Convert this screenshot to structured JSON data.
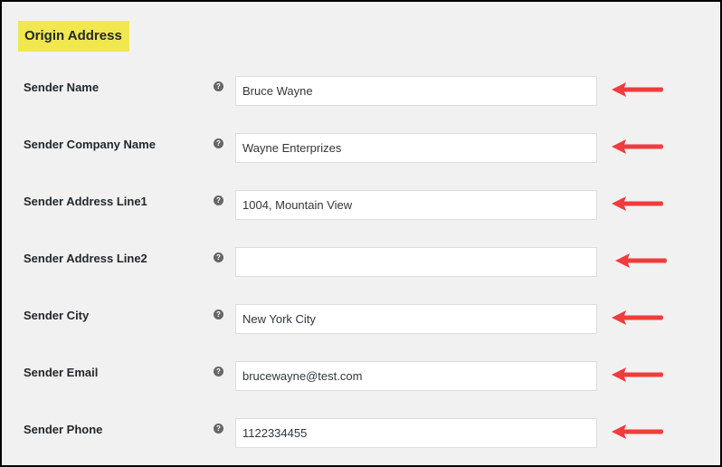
{
  "section": {
    "title": "Origin Address",
    "highlight_color": "#f0e84e"
  },
  "help_icon_glyph": "?",
  "annotation_arrow_color": "#f03c3c",
  "fields": [
    {
      "label": "Sender Name",
      "value": "Bruce Wayne"
    },
    {
      "label": "Sender Company Name",
      "value": "Wayne Enterprizes"
    },
    {
      "label": "Sender Address Line1",
      "value": "1004, Mountain View"
    },
    {
      "label": "Sender Address Line2",
      "value": ""
    },
    {
      "label": "Sender City",
      "value": "New York City"
    },
    {
      "label": "Sender Email",
      "value": "brucewayne@test.com"
    },
    {
      "label": "Sender Phone",
      "value": "1122334455"
    }
  ]
}
